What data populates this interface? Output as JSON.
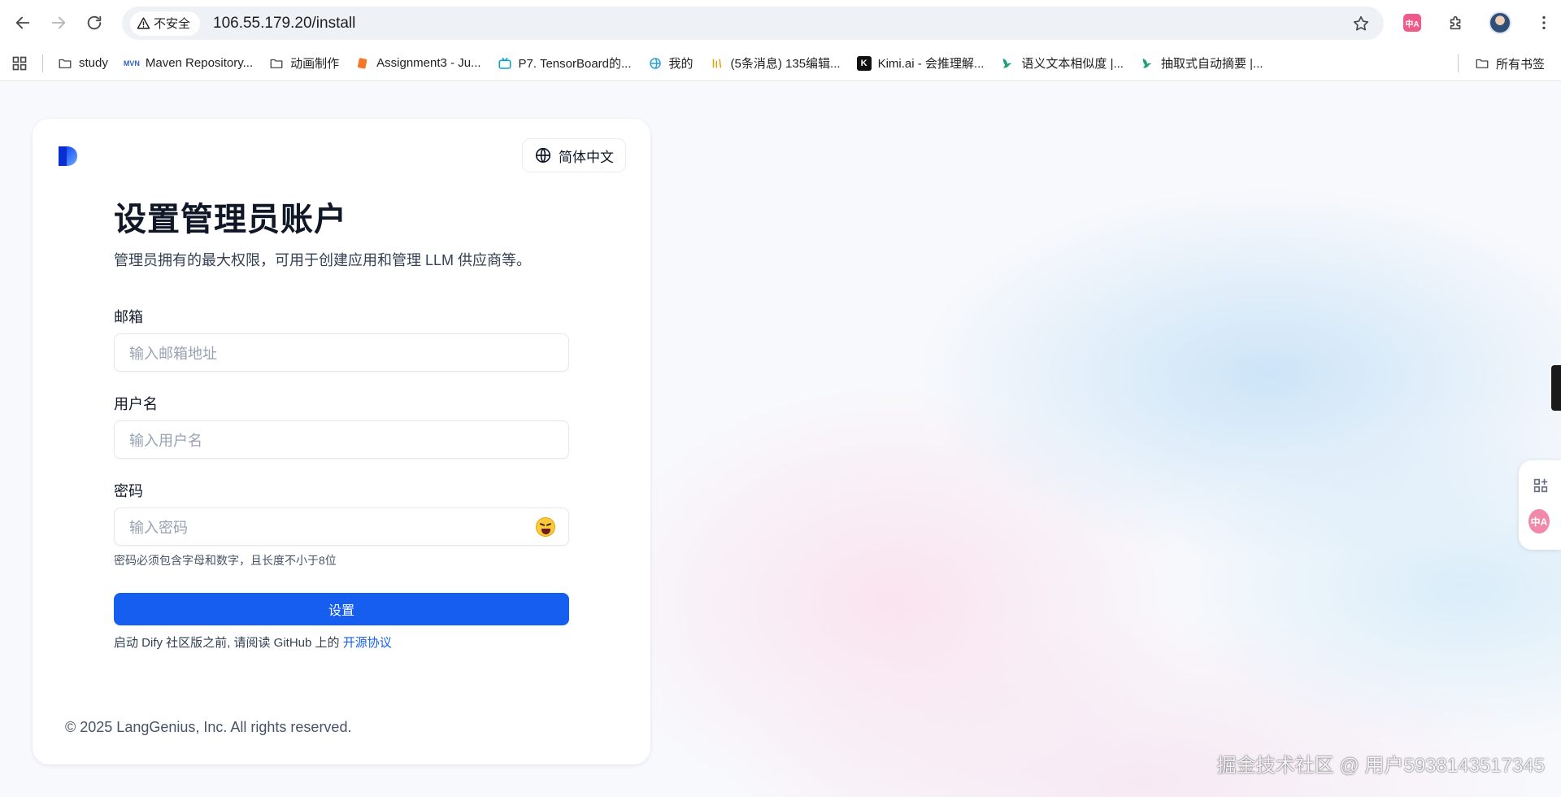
{
  "browser": {
    "security_label": "不安全",
    "url": "106.55.179.20/install"
  },
  "bookmarks": [
    {
      "label": "study",
      "icon": "folder-icon"
    },
    {
      "label": "Maven Repository...",
      "icon": "mvn-icon",
      "badge": "MVN"
    },
    {
      "label": "动画制作",
      "icon": "folder-icon"
    },
    {
      "label": "Assignment3 - Ju...",
      "icon": "jupyter-icon"
    },
    {
      "label": "P7. TensorBoard的...",
      "icon": "bilibili-icon"
    },
    {
      "label": "我的",
      "icon": "globe-icon"
    },
    {
      "label": "(5条消息) 135编辑...",
      "icon": "csdn-icon"
    },
    {
      "label": "Kimi.ai - 会推理解...",
      "icon": "kimi-icon",
      "badge": "K"
    },
    {
      "label": "语义文本相似度 |...",
      "icon": "bird-icon"
    },
    {
      "label": "抽取式自动摘要 |...",
      "icon": "bird-icon"
    }
  ],
  "bookmarks_all": "所有书签",
  "language_button": "简体中文",
  "form": {
    "title": "设置管理员账户",
    "subtitle": "管理员拥有的最大权限，可用于创建应用和管理 LLM 供应商等。",
    "email_label": "邮箱",
    "email_placeholder": "输入邮箱地址",
    "username_label": "用户名",
    "username_placeholder": "输入用户名",
    "password_label": "密码",
    "password_placeholder": "输入密码",
    "password_hint": "密码必须包含字母和数字，且长度不小于8位",
    "submit_label": "设置",
    "license_text": "启动 Dify 社区版之前, 请阅读 GitHub 上的",
    "license_link": "开源协议"
  },
  "footer": "© 2025 LangGenius, Inc. All rights reserved.",
  "translate_badge": "中A",
  "watermark": "掘金技术社区 @ 用户5938143517345",
  "colors": {
    "primary": "#155eef",
    "title": "#101828",
    "translate": "#f05a8a"
  }
}
